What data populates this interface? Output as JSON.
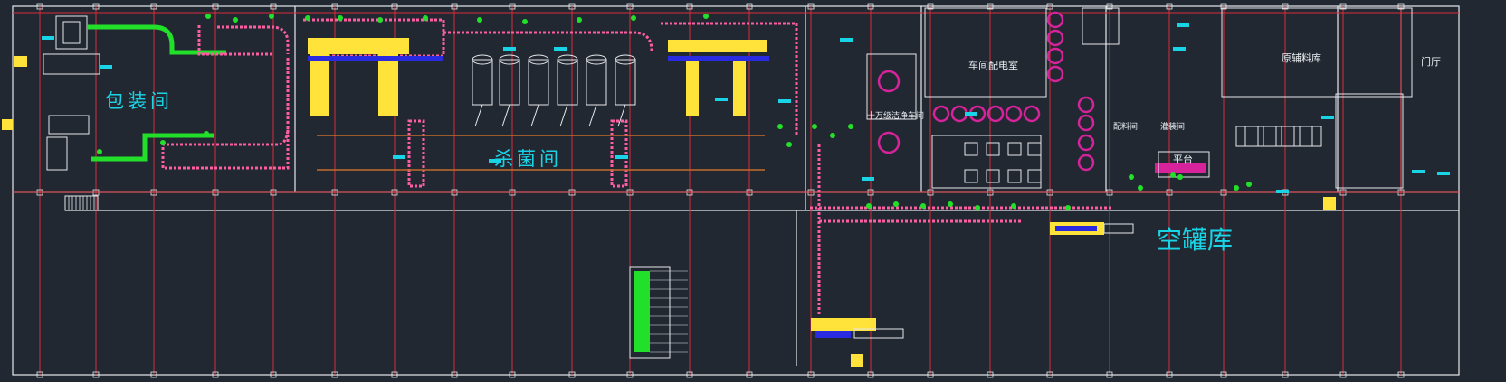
{
  "labels": {
    "packing_room": "包装间",
    "sterilization_room": "杀菌间",
    "empty_can_storage": "空罐库",
    "workshop_office": "车间配电室",
    "raw_material_storage": "原辅料库",
    "clean_area": "十万级洁净车间",
    "mixing_room": "配料间",
    "filling_room": "灌装间",
    "platform": "平台",
    "entrance_hall": "门厅"
  },
  "colors": {
    "background": "#222831",
    "wall_line": "#e6e9ec",
    "grid_axis": "#d92d3a",
    "conveyor": "#ff5da2",
    "equipment": "#ffe23a",
    "vessel": "#d6239b",
    "valve_marker": "#22e02a",
    "annotation": "#19d3e6",
    "machine_blue": "#2a2ae0"
  }
}
